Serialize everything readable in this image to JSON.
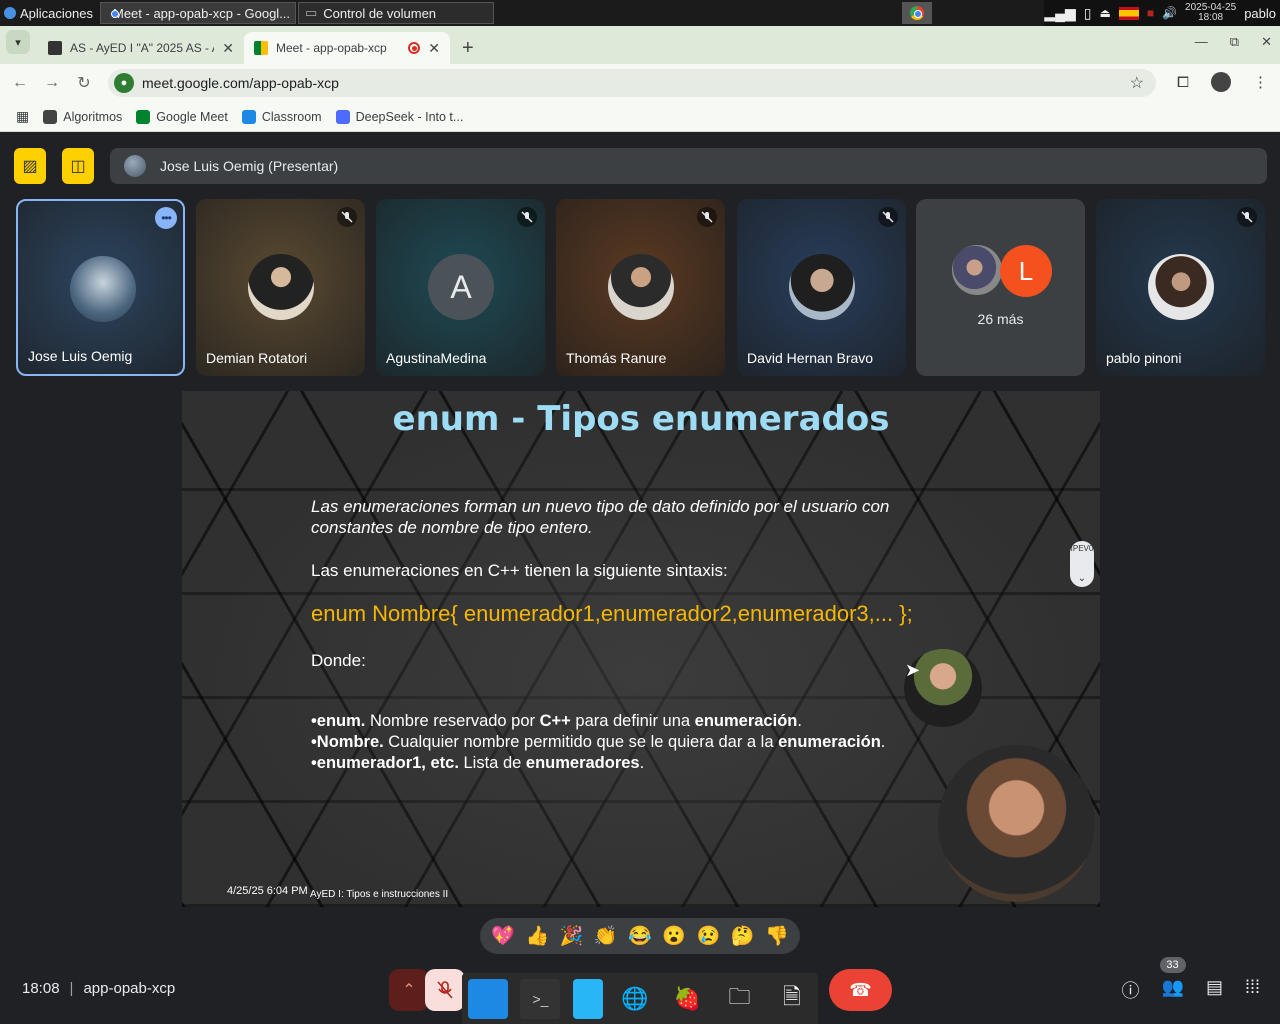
{
  "os_bar": {
    "apps_label": "Aplicaciones",
    "tasks": [
      {
        "label": "Meet - app-opab-xcp - Googl..."
      },
      {
        "label": "Control de volumen"
      }
    ],
    "clock_date": "2025-04-25",
    "clock_time": "18:08",
    "user": "pablo"
  },
  "browser": {
    "tabs": [
      {
        "title": "AS - AyED I \"A\" 2025 AS - Al",
        "close": "✕"
      },
      {
        "title": "Meet - app-opab-xcp",
        "close": "✕"
      }
    ],
    "new_tab": "+",
    "url": "meet.google.com/app-opab-xcp",
    "bookmarks": [
      {
        "label": "Algoritmos",
        "color": "#444444"
      },
      {
        "label": "Google Meet",
        "color": "#00832d"
      },
      {
        "label": "Classroom",
        "color": "#1e88e5"
      },
      {
        "label": "DeepSeek - Into t...",
        "color": "#4d6bfe"
      }
    ]
  },
  "meet": {
    "presenter_label": "Jose Luis Oemig (Presentar)",
    "participants": [
      {
        "name": "Jose Luis Oemig",
        "bg": "#2c4560"
      },
      {
        "name": "Demian Rotatori",
        "bg": "#5a4a32"
      },
      {
        "name": "AgustinaMedina",
        "bg": "#1f4a55",
        "initial": "A"
      },
      {
        "name": "Thomás Ranure",
        "bg": "#5b3a22"
      },
      {
        "name": "David Hernan Bravo",
        "bg": "#283e5c"
      },
      {
        "name": "pablo pinoni",
        "bg": "#24394f"
      }
    ],
    "others_initial": "L",
    "others_count": "26 más",
    "slide": {
      "title": "enum - Tipos enumerados",
      "intro": "Las enumeraciones forman un nuevo tipo de dato definido por el usuario con constantes de nombre de tipo entero.",
      "syntax_intro": "Las enumeraciones en C++ tienen la siguiente sintaxis:",
      "syntax": "enum Nombre{ enumerador1,enumerador2,enumerador3,... };",
      "donde": "Donde:",
      "bullets": [
        {
          "bold": "•enum.",
          "rest": " Nombre reservado por ",
          "bold2": "C++",
          "rest2": " para definir una ",
          "bold3": "enumeración",
          "rest3": "."
        },
        {
          "bold": "•Nombre.",
          "rest": " Cualquier nombre permitido que se le quiera dar a la ",
          "bold2": "enumeración",
          "rest2": ".",
          "bold3": "",
          "rest3": ""
        },
        {
          "bold": "•enumerador1, etc.",
          "rest": " Lista de ",
          "bold2": "enumeradores",
          "rest2": ".",
          "bold3": "",
          "rest3": ""
        }
      ],
      "footer_date": "4/25/25 6:04 PM",
      "footer_title": "AyED I: Tipos e instrucciones II",
      "side_label": "IPEV0"
    },
    "reactions": [
      "💖",
      "👍",
      "🎉",
      "👏",
      "😂",
      "😮",
      "😢",
      "🤔",
      "👎"
    ],
    "time": "18:08",
    "meeting_code": "app-opab-xcp",
    "people_count": "33"
  }
}
